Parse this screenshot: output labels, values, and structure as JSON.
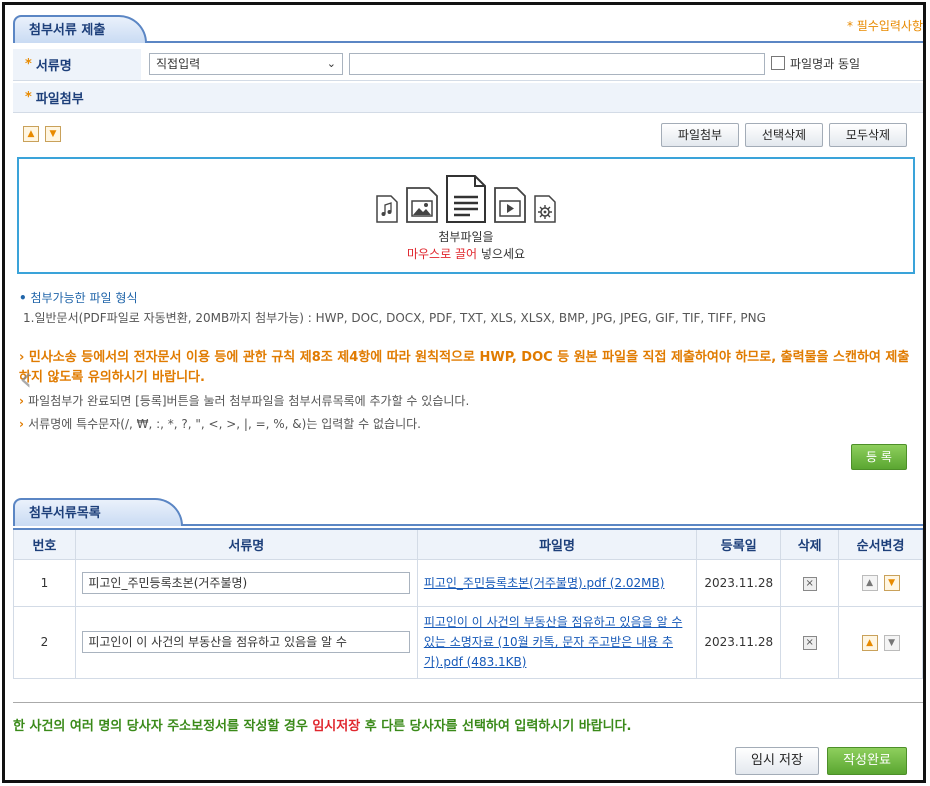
{
  "section1": {
    "tab_title": "첨부서류 제출",
    "required_note": "* 필수입력사항"
  },
  "doc_name_row": {
    "label": "서류명",
    "select_value": "직접입력",
    "same_as_filename_label": "파일명과 동일"
  },
  "file_attach_row": {
    "label": "파일첨부"
  },
  "toolbar": {
    "attach_label": "파일첨부",
    "delete_selected_label": "선택삭제",
    "delete_all_label": "모두삭제"
  },
  "dropzone": {
    "icons": [
      "audio-file-icon",
      "image-file-icon",
      "document-file-icon",
      "video-file-icon",
      "settings-file-icon"
    ],
    "line1": "첨부파일을",
    "line2_highlight": "마우스로 끌어",
    "line2_rest": "넣으세요"
  },
  "allowed": {
    "title": "첨부가능한 파일 형식",
    "line": "1.일반문서(PDF파일로 자동변환, 20MB까지 첨부가능) : HWP, DOC, DOCX, PDF, TXT, XLS, XLSX, BMP, JPG, JPEG, GIF, TIF, TIFF, PNG"
  },
  "notices": {
    "warning": "민사소송 등에서의 전자문서 이용 등에 관한 규칙 제8조 제4항에 따라 원칙적으로 HWP, DOC 등 원본 파일을 직접 제출하여야 하므로, 출력물을 스캔하여 제출하지 않도록 유의하시기 바랍니다.",
    "note1": "파일첨부가 완료되면 [등록]버튼을 눌러 첨부파일을 첨부서류목록에 추가할 수 있습니다.",
    "note2": "서류명에 특수문자(/, ₩, :, *, ?, \", <, >, |, =, %, &)는 입력할 수 없습니다."
  },
  "register_label": "등 록",
  "section2": {
    "tab_title": "첨부서류목록"
  },
  "table": {
    "headers": [
      "번호",
      "서류명",
      "파일명",
      "등록일",
      "삭제",
      "순서변경"
    ],
    "rows": [
      {
        "no": "1",
        "doc_name": "피고인_주민등록초본(거주불명)",
        "file_name": "피고인_주민등록초본(거주불명).pdf (2.02MB)",
        "date": "2023.11.28"
      },
      {
        "no": "2",
        "doc_name": "피고인이 이 사건의 부동산을 점유하고 있음을 알 수",
        "file_name": "피고인이 이 사건의 부동산을 점유하고 있음을 알 수 있는 소명자료 (10월 카톡, 문자 주고받은 내용 추가).pdf (483.1KB)",
        "date": "2023.11.28"
      }
    ]
  },
  "bottom": {
    "msg_pre": "한 사건의 여러 명의 당사자 주소보정서를 작성할 경우",
    "msg_highlight": "임시저장",
    "msg_post": "후 다른 당사자를 선택하여 입력하시기 바랍니다.",
    "temp_save_label": "임시 저장",
    "complete_label": "작성완료"
  },
  "colors": {
    "accent": "#5b86c4",
    "warning": "#e07b00",
    "highlight": "#e0272e",
    "success": "#5aa631"
  }
}
